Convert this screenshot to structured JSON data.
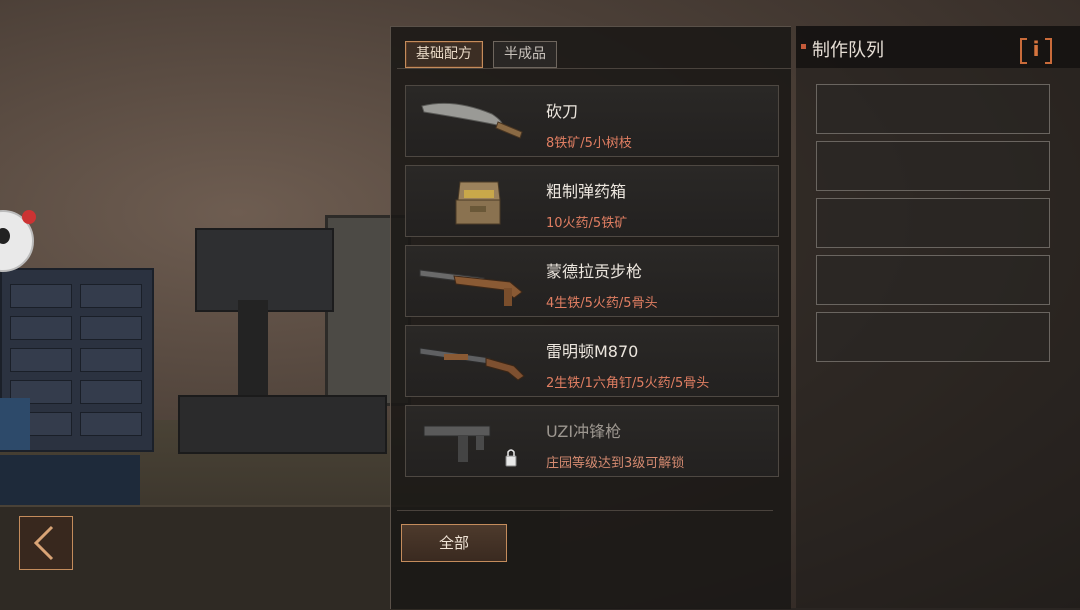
{
  "tabs": [
    "基础配方",
    "半成品"
  ],
  "recipes": [
    {
      "name": "砍刀",
      "req": "8铁矿/5小树枝",
      "icon": "machete-icon"
    },
    {
      "name": "粗制弹药箱",
      "req": "10火药/5铁矿",
      "icon": "ammo-box-icon"
    },
    {
      "name": "蒙德拉贡步枪",
      "req": "4生铁/5火药/5骨头",
      "icon": "rifle-icon"
    },
    {
      "name": "雷明顿M870",
      "req": "2生铁/1六角钉/5火药/5骨头",
      "icon": "shotgun-icon"
    },
    {
      "name": "UZI冲锋枪",
      "req": "庄园等级达到3级可解锁",
      "icon": "uzi-icon",
      "locked": true
    }
  ],
  "filter_button": "全部",
  "queue": {
    "title": "制作队列",
    "info_icon": "i",
    "slot_count": 5
  },
  "colors": {
    "accent": "#c48c5c",
    "requirement": "#e07e62"
  }
}
